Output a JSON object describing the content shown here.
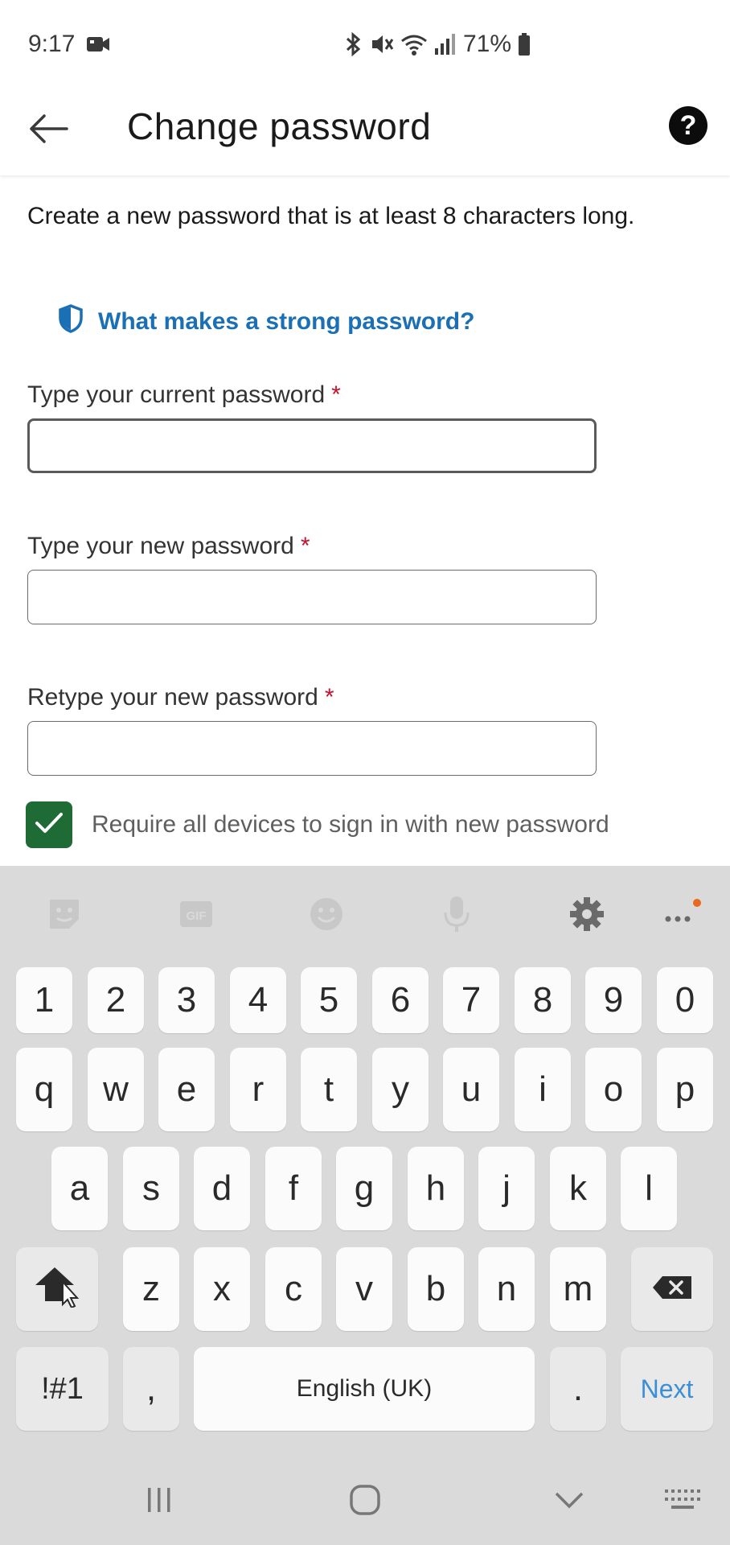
{
  "status_bar": {
    "time": "9:17",
    "battery": "71%",
    "icons": [
      "video-icon",
      "bluetooth-icon",
      "mute-icon",
      "wifi-icon",
      "signal-icon",
      "battery-icon"
    ]
  },
  "app_bar": {
    "title": "Change password",
    "back_icon": "arrow-left-icon",
    "help_label": "?"
  },
  "content": {
    "intro": "Create a new password that is at least 8 characters long.",
    "strong_link": "What makes a strong password?",
    "fields": [
      {
        "label": "Type your current password",
        "required": "*",
        "value": ""
      },
      {
        "label": "Type your new password",
        "required": "*",
        "value": ""
      },
      {
        "label": "Retype your new password",
        "required": "*",
        "value": ""
      }
    ],
    "checkbox": {
      "label": "Require all devices to sign in with new password",
      "checked": true
    }
  },
  "keyboard": {
    "toolbar": [
      "sticker-icon",
      "gif-icon",
      "emoji-icon",
      "mic-icon",
      "settings-icon",
      "more-icon"
    ],
    "gif_label": "GIF",
    "row_numbers": [
      "1",
      "2",
      "3",
      "4",
      "5",
      "6",
      "7",
      "8",
      "9",
      "0"
    ],
    "row_q": [
      "q",
      "w",
      "e",
      "r",
      "t",
      "y",
      "u",
      "i",
      "o",
      "p"
    ],
    "row_a": [
      "a",
      "s",
      "d",
      "f",
      "g",
      "h",
      "j",
      "k",
      "l"
    ],
    "row_z": [
      "z",
      "x",
      "c",
      "v",
      "b",
      "n",
      "m"
    ],
    "symbols_label": "!#1",
    "comma_label": ",",
    "space_label": "English (UK)",
    "period_label": ".",
    "next_label": "Next"
  },
  "nav_bar": {
    "icons": [
      "recent-apps-icon",
      "home-icon",
      "back-chevron-icon",
      "keyboard-icon"
    ]
  },
  "colors": {
    "accent_link": "#1a6fb5",
    "checkbox_green": "#1e6b36",
    "required_red": "#c8102e",
    "next_blue": "#3c8fd6"
  }
}
